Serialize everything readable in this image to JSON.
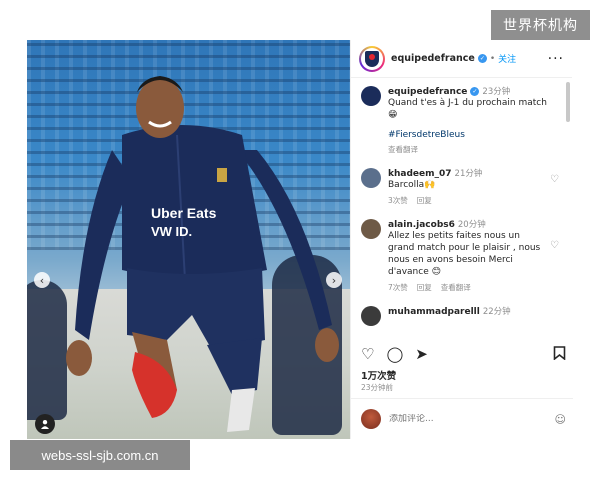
{
  "watermarks": {
    "top": "世界杯机构",
    "bottom": "webs-ssl-sjb.com.cn"
  },
  "post": {
    "username": "equipedefrance",
    "verified_glyph": "✓",
    "separator": "•",
    "follow_label": "关注",
    "more_label": "···",
    "sponsor_text": "Uber Eats",
    "sponsor_text2": "VW ID."
  },
  "comments": [
    {
      "user": "equipedefrance",
      "time": "23分钟",
      "text": "Quand t'es à J-1 du prochain match 😁",
      "hashtag": "#FiersdetreBleus",
      "meta": [
        "查看翻译"
      ],
      "avatar_color": "#1b2c5a",
      "author": true
    },
    {
      "user": "khadeem_07",
      "time": "21分钟",
      "text": "Barcolla🙌",
      "meta": [
        "3次赞",
        "回复"
      ],
      "avatar_color": "#5b6f8c"
    },
    {
      "user": "alain.jacobs6",
      "time": "20分钟",
      "text": "Allez les petits faites nous un grand match pour le plaisir , nous nous en avons besoin Merci d'avance 😊",
      "meta": [
        "7次赞",
        "回复",
        "查看翻译"
      ],
      "avatar_color": "#6e5a46"
    },
    {
      "user": "muhammadparelll",
      "time": "22分钟",
      "text": "",
      "meta": [],
      "avatar_color": "#3b3b3b"
    }
  ],
  "actions": {
    "like": "♡",
    "comment": "◯",
    "share": "➤",
    "save": "⌑"
  },
  "likes": "1万次赞",
  "date": "23分钟前",
  "add_comment": {
    "placeholder": "添加评论...",
    "emoji": "☺"
  },
  "nav": {
    "prev": "‹",
    "next": "›"
  },
  "colors": {
    "link": "#0095f6",
    "jersey": "#1b2c5a",
    "boot": "#d6322b"
  }
}
